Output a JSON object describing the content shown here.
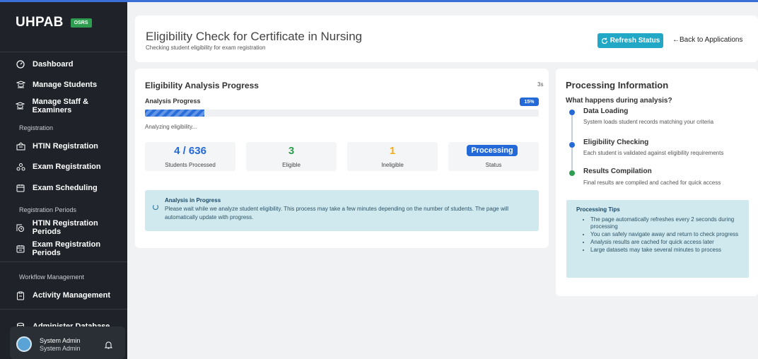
{
  "sidebar": {
    "brand": "UHPAB",
    "badge": "OSRS",
    "items": [
      {
        "label": "Dashboard",
        "icon": "dashboard-icon"
      },
      {
        "label": "Manage Students",
        "icon": "students-icon"
      },
      {
        "label": "Manage Staff & Examiners",
        "icon": "staff-icon"
      }
    ],
    "section_registration": "Registration",
    "registration_items": [
      {
        "label": "HTIN Registration",
        "icon": "htin-icon"
      },
      {
        "label": "Exam Registration",
        "icon": "exam-registration-icon"
      },
      {
        "label": "Exam Scheduling",
        "icon": "calendar-icon"
      }
    ],
    "section_periods": "Registration Periods",
    "period_items": [
      {
        "label": "HTIN Registration Periods",
        "icon": "period-icon"
      },
      {
        "label": "Exam Registration Periods",
        "icon": "calendar-period-icon"
      }
    ],
    "section_workflow": "Workflow Management",
    "workflow_items": [
      {
        "label": "Activity Management",
        "icon": "clipboard-icon"
      }
    ],
    "admin_item": "Administer Database",
    "user": {
      "name": "System Admin",
      "role": "System Admin"
    }
  },
  "header": {
    "title": "Eligibility Check for Certificate in Nursing",
    "subtitle": "Checking student eligibility for exam registration",
    "refresh_label": "Refresh Status",
    "back_label": "Back to Applications"
  },
  "analysis": {
    "title": "Eligibility Analysis Progress",
    "elapsed": "3s",
    "progress_label": "Analysis Progress",
    "progress_percent_label": "15%",
    "progress_value": 0.15,
    "status_text": "Analyzing eligibility...",
    "stats": [
      {
        "value": "4 / 636",
        "label": "Students Processed",
        "color": "#2469d8"
      },
      {
        "value": "3",
        "label": "Eligible",
        "color": "#2e9d4f"
      },
      {
        "value": "1",
        "label": "Ineligible",
        "color": "#f0ad1e"
      },
      {
        "value": "Processing",
        "label": "Status",
        "color": "#2469d8"
      }
    ],
    "info_title": "Analysis in Progress",
    "info_text": "Please wait while we analyze student eligibility. This process may take a few minutes depending on the number of students. The page will automatically update with progress."
  },
  "processing": {
    "title": "Processing Information",
    "question": "What happens during analysis?",
    "steps": [
      {
        "title": "Data Loading",
        "desc": "System loads student records matching your criteria",
        "color": "#2469d8"
      },
      {
        "title": "Eligibility Checking",
        "desc": "Each student is validated against eligibility requirements",
        "color": "#2469d8"
      },
      {
        "title": "Results Compilation",
        "desc": "Final results are compiled and cached for quick access",
        "color": "#2e9d4f"
      }
    ],
    "tips_title": "Processing Tips",
    "tips": [
      "The page automatically refreshes every 2 seconds during processing",
      "You can safely navigate away and return to check progress",
      "Analysis results are cached for quick access later",
      "Large datasets may take several minutes to process"
    ]
  }
}
